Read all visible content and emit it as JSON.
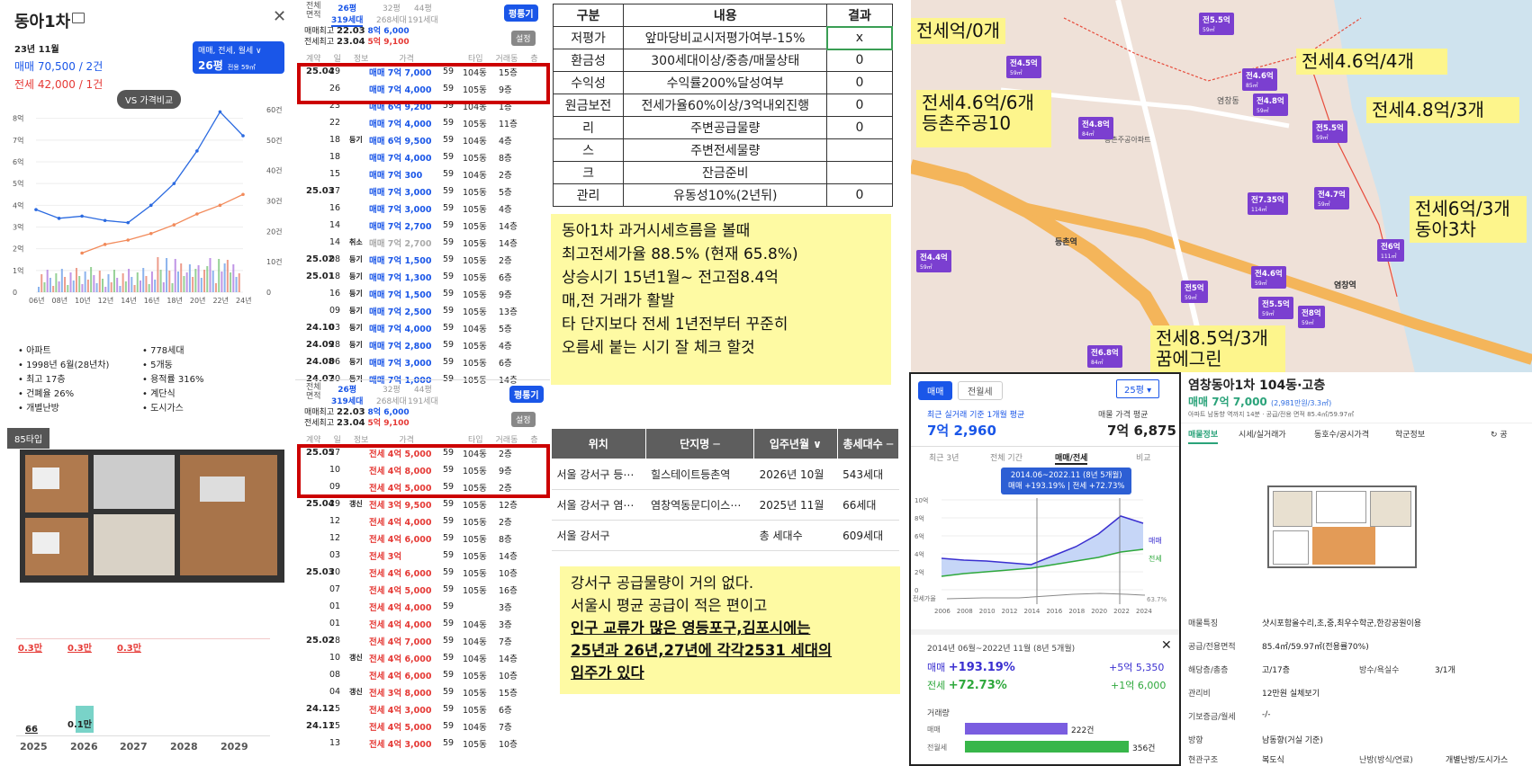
{
  "p1": {
    "title": "동아1차",
    "date": "23년 11월",
    "sale": "매매 70,500 / 2건",
    "jeonse": "전세 42,000 / 1건",
    "type_btn": "매매, 전세, 월세 ∨",
    "size_btn": "26평",
    "size_sub": "전용 59㎡",
    "vs_btn": "VS 가격비교",
    "y_left": [
      "8억",
      "7억",
      "6억",
      "5억",
      "4억",
      "3억",
      "2억",
      "1억",
      "0"
    ],
    "y_right": [
      "60건",
      "50건",
      "40건",
      "30건",
      "20건",
      "10건",
      "0"
    ],
    "x_ticks": [
      "06년",
      "08년",
      "10년",
      "12년",
      "14년",
      "16년",
      "18년",
      "20년",
      "22년",
      "24년"
    ],
    "info_left": [
      "아파트",
      "1998년 6월(28년차)",
      "최고 17층",
      "건폐율 26%",
      "개별난방"
    ],
    "info_right": [
      "778세대",
      "5개동",
      "용적률 316%",
      "계단식",
      "도시가스"
    ],
    "plan_label": "85타입",
    "small_vals": [
      "0.3만",
      "0.3만",
      "0.3만"
    ],
    "supply_66": "66",
    "supply_01": "0.1만",
    "years": [
      "2025",
      "2026",
      "2027",
      "2028",
      "2029"
    ]
  },
  "p2": {
    "hdr_labels": [
      "전체",
      "면적"
    ],
    "tabs": [
      {
        "a": "26평",
        "b": "319세대"
      },
      {
        "a": "32평",
        "b": "268세대"
      },
      {
        "a": "44평",
        "b": "191세대"
      }
    ],
    "pyeong_btn": "평통기",
    "setting_btn": "설정",
    "max_sale_label": "매매최고",
    "max_sale_date": "22.03",
    "max_sale_price": "8억 6,000",
    "max_jeon_label": "전세최고",
    "max_jeon_date": "23.04",
    "max_jeon_price": "5억 9,100",
    "cols": [
      "계약",
      "일",
      "정보",
      "가격",
      "타입",
      "거래동",
      "층"
    ],
    "sale_rows": [
      {
        "d": "25.04",
        "day": "29",
        "tag": "",
        "p": "매매 7억 7,000",
        "s": "59",
        "dong": "104동",
        "fl": "15층"
      },
      {
        "d": "",
        "day": "26",
        "tag": "",
        "p": "매매 7억 4,000",
        "s": "59",
        "dong": "105동",
        "fl": "9층"
      },
      {
        "d": "",
        "day": "23",
        "tag": "",
        "p": "매매 6억 9,200",
        "s": "59",
        "dong": "104동",
        "fl": "1층"
      },
      {
        "d": "",
        "day": "22",
        "tag": "",
        "p": "매매 7억 4,000",
        "s": "59",
        "dong": "105동",
        "fl": "11층"
      },
      {
        "d": "",
        "day": "18",
        "tag": "등기",
        "p": "매매 6억 9,500",
        "s": "59",
        "dong": "104동",
        "fl": "4층"
      },
      {
        "d": "",
        "day": "18",
        "tag": "",
        "p": "매매 7억 4,000",
        "s": "59",
        "dong": "105동",
        "fl": "8층"
      },
      {
        "d": "",
        "day": "15",
        "tag": "",
        "p": "매매 7억 300",
        "s": "59",
        "dong": "104동",
        "fl": "2층"
      },
      {
        "d": "25.03",
        "day": "27",
        "tag": "",
        "p": "매매 7억 3,000",
        "s": "59",
        "dong": "105동",
        "fl": "5층"
      },
      {
        "d": "",
        "day": "16",
        "tag": "",
        "p": "매매 7억 3,000",
        "s": "59",
        "dong": "105동",
        "fl": "4층"
      },
      {
        "d": "",
        "day": "14",
        "tag": "",
        "p": "매매 7억 2,700",
        "s": "59",
        "dong": "105동",
        "fl": "14층"
      },
      {
        "d": "",
        "day": "14",
        "tag": "취소",
        "p": "매매 7억 2,700",
        "s": "59",
        "dong": "105동",
        "fl": "14층"
      },
      {
        "d": "25.02",
        "day": "08",
        "tag": "등기",
        "p": "매매 7억 1,500",
        "s": "59",
        "dong": "105동",
        "fl": "2층"
      },
      {
        "d": "25.01",
        "day": "18",
        "tag": "등기",
        "p": "매매 7억 1,300",
        "s": "59",
        "dong": "105동",
        "fl": "6층"
      },
      {
        "d": "",
        "day": "16",
        "tag": "등기",
        "p": "매매 7억 1,500",
        "s": "59",
        "dong": "105동",
        "fl": "9층"
      },
      {
        "d": "",
        "day": "09",
        "tag": "등기",
        "p": "매매 7억 2,500",
        "s": "59",
        "dong": "105동",
        "fl": "13층"
      },
      {
        "d": "24.10",
        "day": "03",
        "tag": "등기",
        "p": "매매 7억 4,000",
        "s": "59",
        "dong": "104동",
        "fl": "5층"
      },
      {
        "d": "24.09",
        "day": "28",
        "tag": "등기",
        "p": "매매 7억 2,800",
        "s": "59",
        "dong": "105동",
        "fl": "4층"
      },
      {
        "d": "24.08",
        "day": "06",
        "tag": "등기",
        "p": "매매 7억 3,000",
        "s": "59",
        "dong": "105동",
        "fl": "6층"
      },
      {
        "d": "24.07",
        "day": "30",
        "tag": "등기",
        "p": "매매 7억 1,000",
        "s": "59",
        "dong": "105동",
        "fl": "14층"
      }
    ],
    "jeon_rows": [
      {
        "d": "25.05",
        "day": "27",
        "tag": "",
        "p": "전세 4억 5,000",
        "s": "59",
        "dong": "104동",
        "fl": "2층"
      },
      {
        "d": "",
        "day": "10",
        "tag": "",
        "p": "전세 4억 8,000",
        "s": "59",
        "dong": "105동",
        "fl": "9층"
      },
      {
        "d": "",
        "day": "09",
        "tag": "",
        "p": "전세 4억 5,000",
        "s": "59",
        "dong": "105동",
        "fl": "2층"
      },
      {
        "d": "25.04",
        "day": "29",
        "tag": "갱신",
        "p": "전세 3억 9,500",
        "s": "59",
        "dong": "105동",
        "fl": "12층"
      },
      {
        "d": "",
        "day": "12",
        "tag": "",
        "p": "전세 4억 4,000",
        "s": "59",
        "dong": "105동",
        "fl": "2층"
      },
      {
        "d": "",
        "day": "12",
        "tag": "",
        "p": "전세 4억 6,000",
        "s": "59",
        "dong": "105동",
        "fl": "8층"
      },
      {
        "d": "",
        "day": "03",
        "tag": "",
        "p": "전세 3억",
        "s": "59",
        "dong": "105동",
        "fl": "14층"
      },
      {
        "d": "25.03",
        "day": "20",
        "tag": "",
        "p": "전세 4억 6,000",
        "s": "59",
        "dong": "105동",
        "fl": "10층"
      },
      {
        "d": "",
        "day": "07",
        "tag": "",
        "p": "전세 4억 5,000",
        "s": "59",
        "dong": "105동",
        "fl": "16층"
      },
      {
        "d": "",
        "day": "01",
        "tag": "",
        "p": "전세 4억 4,000",
        "s": "59",
        "dong": "",
        "fl": "3층"
      },
      {
        "d": "",
        "day": "01",
        "tag": "",
        "p": "전세 4억 4,000",
        "s": "59",
        "dong": "104동",
        "fl": "3층"
      },
      {
        "d": "25.02",
        "day": "28",
        "tag": "",
        "p": "전세 4억 7,000",
        "s": "59",
        "dong": "104동",
        "fl": "7층"
      },
      {
        "d": "",
        "day": "10",
        "tag": "갱신",
        "p": "전세 4억 6,000",
        "s": "59",
        "dong": "104동",
        "fl": "14층"
      },
      {
        "d": "",
        "day": "08",
        "tag": "",
        "p": "전세 4억 6,000",
        "s": "59",
        "dong": "105동",
        "fl": "10층"
      },
      {
        "d": "",
        "day": "04",
        "tag": "갱신",
        "p": "전세 3억 8,000",
        "s": "59",
        "dong": "105동",
        "fl": "15층"
      },
      {
        "d": "24.12",
        "day": "15",
        "tag": "",
        "p": "전세 4억 3,000",
        "s": "59",
        "dong": "105동",
        "fl": "6층"
      },
      {
        "d": "24.11",
        "day": "25",
        "tag": "",
        "p": "전세 4억 5,000",
        "s": "59",
        "dong": "104동",
        "fl": "7층"
      },
      {
        "d": "",
        "day": "13",
        "tag": "",
        "p": "전세 4억 3,000",
        "s": "59",
        "dong": "105동",
        "fl": "10층"
      }
    ]
  },
  "p3": {
    "headers": [
      "구분",
      "내용",
      "결과"
    ],
    "rows": [
      {
        "a": "저평가",
        "b": "앞마당비교시저평가여부-15%",
        "c": "x"
      },
      {
        "a": "환금성",
        "b": "300세대이상/중층/매물상태",
        "c": "0"
      },
      {
        "a": "수익성",
        "b": "수익률200%달성여부",
        "c": "0"
      },
      {
        "a": "원금보전",
        "b": "전세가율60%이상/3억내외진행",
        "c": "0"
      },
      {
        "a": "리",
        "b": "주변공급물량",
        "c": "0"
      },
      {
        "a": "스",
        "b": "주변전세물량",
        "c": ""
      },
      {
        "a": "크",
        "b": "잔금준비",
        "c": ""
      },
      {
        "a": "관리",
        "b": "유동성10%(2년뒤)",
        "c": "0"
      }
    ],
    "note1": [
      "동아1차 과거시세흐름을 볼때",
      "최고전세가율 88.5% (현재 65.8%)",
      "상승시기 15년1월~ 전고점8.4억",
      "매,전 거래가 활발",
      "타 단지보다 전세 1년전부터 꾸준히",
      "오름세 붙는 시기 잘 체크 할것"
    ],
    "st_headers": [
      "위치",
      "단지명 ─",
      "입주년월 ∨",
      "총세대수 ─"
    ],
    "st_rows": [
      {
        "a": "서울 강서구 등⋯",
        "b": "힐스테이트등촌역",
        "c": "2026년 10월",
        "d": "543세대"
      },
      {
        "a": "서울 강서구 염⋯",
        "b": "염창역동문디이스⋯",
        "c": "2025년 11월",
        "d": "66세대"
      },
      {
        "a": "서울 강서구",
        "b": "",
        "c": "총 세대수",
        "d": "609세대"
      }
    ],
    "note2_plain": [
      "강서구 공급물량이 거의 없다.",
      "서울시 평균 공급이 적은 편이고"
    ],
    "note2_bold": [
      " 인구 교류가 많은 영등포구,김포시에는",
      "25년과 26년,27년에 각각2531 세대의",
      "입주가  있다"
    ]
  },
  "p4": {
    "labels": [
      {
        "t": "전세억/0개"
      },
      {
        "t": "전세4.6억/6개\n등촌주공10"
      },
      {
        "t": "전세4.6억/4개"
      },
      {
        "t": "전세4.8억/3개"
      },
      {
        "t": "전세6억/3개\n동아3차"
      },
      {
        "t": "전세8.5억/3개\n꿈에그린"
      }
    ],
    "pins": [
      {
        "t": "전5.5억",
        "s": "59㎡"
      },
      {
        "t": "전4.5억",
        "s": "59㎡"
      },
      {
        "t": "전4.6억",
        "s": "85㎡"
      },
      {
        "t": "전4.8억",
        "s": "59㎡"
      },
      {
        "t": "전5.5억",
        "s": "59㎡"
      },
      {
        "t": "전4.8억",
        "s": "84㎡"
      },
      {
        "t": "전7.35억",
        "s": "114㎡"
      },
      {
        "t": "전4.7억",
        "s": "59㎡"
      },
      {
        "t": "전6억",
        "s": "111㎡"
      },
      {
        "t": "전4.4억",
        "s": "59㎡"
      },
      {
        "t": "전5억",
        "s": "59㎡"
      },
      {
        "t": "전4.6억",
        "s": "59㎡"
      },
      {
        "t": "전5.5억",
        "s": "59㎡"
      },
      {
        "t": "전8억",
        "s": "59㎡"
      },
      {
        "t": "전6.8억",
        "s": "84㎡"
      }
    ],
    "places": [
      "등촌역",
      "염창역",
      "등촌주공아파트",
      "염창동"
    ]
  },
  "p5": {
    "tab1": "매매",
    "tab2": "전월세",
    "size": "25평 ▾",
    "avg_label": "최근 실거래 기준 1개월 평균",
    "avg_value": "7억 2,960",
    "ask_label": "매물 가격 평균",
    "ask_value": "7억 6,875",
    "range_tabs": [
      "최근 3년",
      "전체 기간",
      "매매/전세",
      "비교"
    ],
    "tooltip1": "2014.06~2022.11 (8년 5개월)",
    "tooltip2": "매매 +193.19% | 전세 +72.73%",
    "y_ticks": [
      "10억",
      "8억",
      "6억",
      "4억",
      "2억",
      "0"
    ],
    "jeonse_rate_label": "전세가율",
    "rate_value": "63.7%",
    "x_years": [
      "2006",
      "2008",
      "2010",
      "2012",
      "2014",
      "2016",
      "2018",
      "2020",
      "2022",
      "2024"
    ],
    "legend_sale": "매매",
    "legend_jeon": "전세",
    "period": "2014년 06월~2022년 11월 (8년 5개월)",
    "sale_label": "매매",
    "sale_pct": "+193.19%",
    "sale_amt": "+5억 5,350",
    "jeon_label": "전세",
    "jeon_pct": "+72.73%",
    "jeon_amt": "+1억 6,000",
    "vol_label": "거래량",
    "vol_sale_label": "매매",
    "vol_sale": "222건",
    "vol_jeon_label": "전월세",
    "vol_jeon": "356건"
  },
  "p6": {
    "title": "염창동아1차 104동·고층",
    "price": "매매 7억 7,000",
    "price_sub": "(2,981만원/3.3㎡)",
    "sub": "아파트  남동향  역까지 14분 · 공급/전용 면적 85.4㎡/59.97㎡",
    "tabs": [
      "매물정보",
      "시세/실거래가",
      "동호수/공시가격",
      "학군정보"
    ],
    "share": "↻ 공",
    "details": [
      {
        "k": "매물특징",
        "v": "샷시포함올수리,초,중,최우수학군,한강공원이용"
      },
      {
        "k": "공급/전용면적",
        "v": "85.4㎡/59.97㎡(전용률70%)"
      },
      {
        "k": "해당층/총층",
        "v": "고/17층"
      },
      {
        "k": "관리비",
        "v": "12만원 실체보기"
      },
      {
        "k": "기보증금/월세",
        "v": "-/-"
      },
      {
        "k": "방향",
        "v": "남동향(거실 기준)"
      },
      {
        "k": "현관구조",
        "v": "복도식"
      }
    ],
    "rooms_label": "방수/욕실수",
    "rooms_value": "3/1개",
    "heat_label": "난방(방식/연료)",
    "heat_value": "개별난방/도시가스"
  },
  "chart_data": [
    {
      "type": "line",
      "x": [
        "06년",
        "08년",
        "10년",
        "12년",
        "14년",
        "16년",
        "18년",
        "20년",
        "22년",
        "24년"
      ],
      "series": [
        {
          "name": "매매",
          "values": [
            3.8,
            3.4,
            3.5,
            3.3,
            3.2,
            4.0,
            5.0,
            6.5,
            8.3,
            7.2
          ]
        },
        {
          "name": "전세",
          "values": [
            null,
            null,
            1.8,
            2.2,
            2.4,
            2.7,
            3.1,
            3.6,
            4.0,
            4.5
          ]
        }
      ],
      "ylabel": "",
      "ylim": [
        0,
        8.4
      ]
    },
    {
      "type": "line",
      "x": [
        "2006",
        "2008",
        "2010",
        "2012",
        "2014",
        "2016",
        "2018",
        "2020",
        "2022",
        "2024"
      ],
      "series": [
        {
          "name": "매매",
          "values": [
            3.5,
            3.3,
            3.2,
            3.0,
            2.8,
            3.8,
            4.8,
            6.2,
            8.2,
            7.4
          ]
        },
        {
          "name": "전세",
          "values": [
            1.5,
            1.8,
            2.0,
            2.2,
            2.4,
            2.8,
            3.2,
            3.6,
            4.2,
            4.5
          ]
        }
      ],
      "ylim": [
        0,
        10
      ]
    }
  ]
}
